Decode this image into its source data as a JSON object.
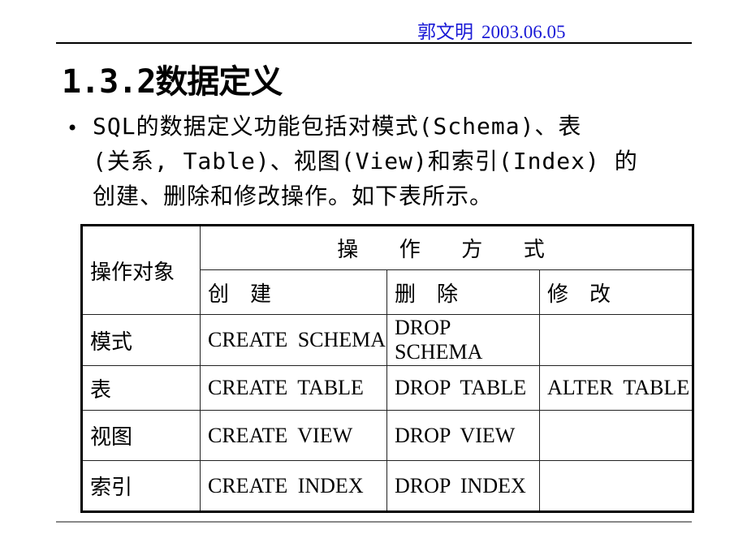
{
  "header": {
    "author": "郭文明",
    "date": "2003.06.05",
    "author_color": "#1a1ad6"
  },
  "title": "1.3.2数据定义",
  "bullet": {
    "line1": "SQL的数据定义功能包括对模式(Schema)、表",
    "line2": "(关系, Table)、视图(View)和索引(Index) 的",
    "line3": "创建、删除和修改操作。如下表所示。"
  },
  "table": {
    "object_header": "操作对象",
    "ops_header": "操 作 方 式",
    "columns": [
      "创　建",
      "删　除",
      "修　改"
    ],
    "rows": [
      {
        "object": "模式",
        "create": "CREATE SCHEMA",
        "drop": "DROP SCHEMA",
        "alter": ""
      },
      {
        "object": "表",
        "create": "CREATE TABLE",
        "drop": "DROP TABLE",
        "alter": "ALTER TABLE"
      },
      {
        "object": "视图",
        "create": "CREATE VIEW",
        "drop": "DROP VIEW",
        "alter": ""
      },
      {
        "object": "索引",
        "create": "CREATE INDEX",
        "drop": "DROP INDEX",
        "alter": ""
      }
    ]
  }
}
